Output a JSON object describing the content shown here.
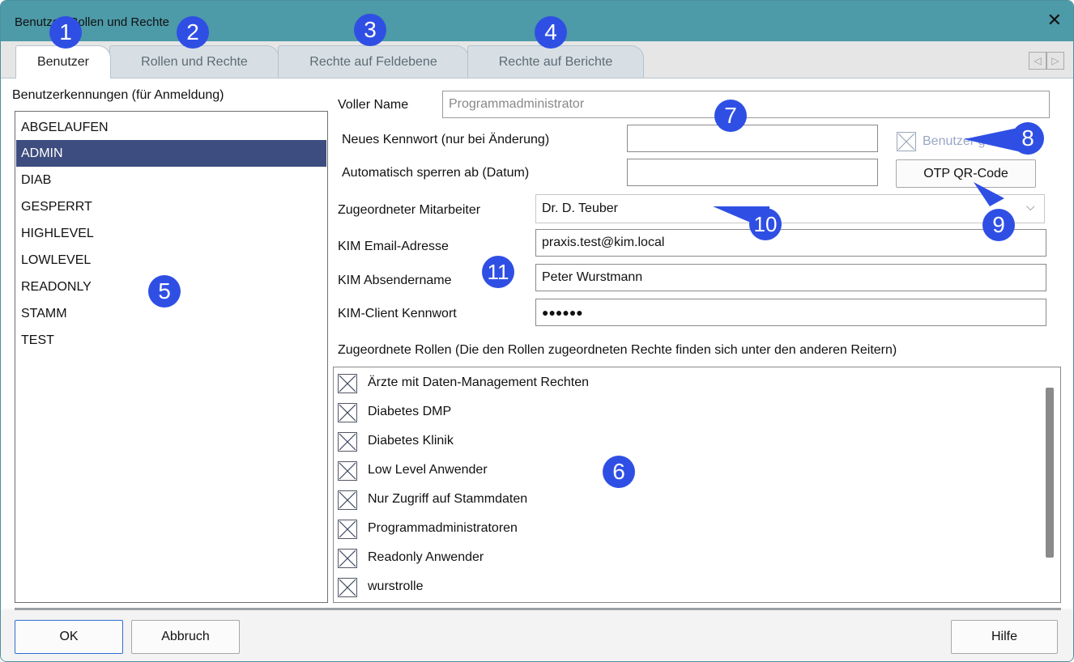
{
  "window": {
    "title": "Benutzer, Rollen und Rechte",
    "close_glyph": "✕"
  },
  "tabs": [
    {
      "label": "Benutzer",
      "active": true
    },
    {
      "label": "Rollen und Rechte",
      "active": false
    },
    {
      "label": "Rechte auf Feldebene",
      "active": false
    },
    {
      "label": "Rechte auf Berichte",
      "active": false
    }
  ],
  "tab_scroll": {
    "left": "◁",
    "right": "▷"
  },
  "users": {
    "heading": "Benutzerkennungen (für Anmeldung)",
    "items": [
      "ABGELAUFEN",
      "ADMIN",
      "DIAB",
      "GESPERRT",
      "HIGHLEVEL",
      "LOWLEVEL",
      "READONLY",
      "STAMM",
      "TEST"
    ],
    "selected": "ADMIN"
  },
  "form": {
    "full_name_label": "Voller Name",
    "full_name_value": "Programmadministrator",
    "new_password_label": "Neues Kennwort (nur bei Änderung)",
    "new_password_value": "",
    "auto_lock_label": "Automatisch sperren ab (Datum)",
    "auto_lock_value": "",
    "locked_checkbox_label": "Benutzer gesperrt",
    "otp_button": "OTP QR-Code",
    "employee_label": "Zugeordneter Mitarbeiter",
    "employee_value": "Dr. D. Teuber",
    "dropdown_glyph": "⌵",
    "kim_email_label": "KIM Email-Adresse",
    "kim_email_value": "praxis.test@kim.local",
    "kim_sender_label": "KIM Absendername",
    "kim_sender_value": "Peter Wurstmann",
    "kim_password_label": "KIM-Client Kennwort",
    "kim_password_value": "●●●●●●"
  },
  "roles": {
    "heading": "Zugeordnete Rollen (Die den Rollen zugeordneten Rechte finden sich unter den anderen Reitern)",
    "items": [
      "Ärzte mit Daten-Management Rechten",
      "Diabetes DMP",
      "Diabetes Klinik",
      "Low Level Anwender",
      "Nur Zugriff auf Stammdaten",
      "Programmadministratoren",
      "Readonly Anwender",
      "wurstrolle"
    ]
  },
  "buttons": {
    "ok": "OK",
    "cancel": "Abbruch",
    "help": "Hilfe"
  },
  "callouts": [
    "1",
    "2",
    "3",
    "4",
    "5",
    "6",
    "7",
    "8",
    "9",
    "10",
    "11"
  ],
  "colors": {
    "titlebar": "#4d9aa8",
    "selection": "#3e4d7f",
    "callout": "#2f4fe4"
  }
}
